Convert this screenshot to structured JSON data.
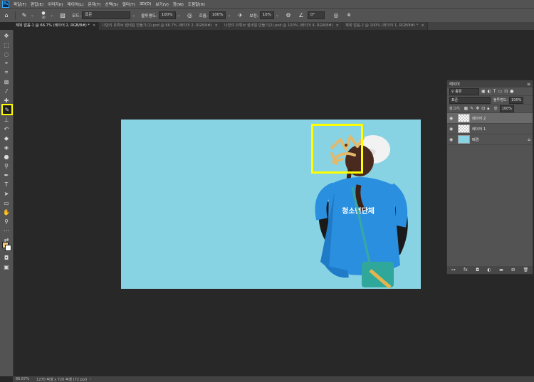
{
  "app": {
    "logo": "Ps"
  },
  "menu": [
    "파일(F)",
    "편집(E)",
    "이미지(I)",
    "레이어(L)",
    "문자(Y)",
    "선택(S)",
    "필터(T)",
    "3D(D)",
    "보기(V)",
    "창(W)",
    "도움말(H)"
  ],
  "options": {
    "brush_size": "30",
    "mode_label": "모드:",
    "mode_value": "표준",
    "opacity_label": "불투명도:",
    "opacity_value": "100%",
    "flow_label": "흐름:",
    "flow_value": "100%",
    "smoothing_label": "보정:",
    "smoothing_value": "10%",
    "angle_value": "0°"
  },
  "tabs": [
    {
      "label": "제목 없음-1 @ 66.7% (레이어 2, RGB/8#) *",
      "active": true
    },
    {
      "label": "나만의 유튜브 썸네일 만들기(1).psd @ 66.7% (레이어 2, RGB/8#)",
      "active": false
    },
    {
      "label": "나만의 유튜브 썸네일 만들기(2).psd @ 100% (레이어 4, RGB/8#)",
      "active": false
    },
    {
      "label": "제목 없음-2 @ 100% (레이어 1, RGB/8#) *",
      "active": false
    }
  ],
  "status": {
    "zoom": "66.67%",
    "doc_info": "1270 픽셀 x 720 픽셀 (72 ppi)"
  },
  "layers_panel": {
    "title": "레이어",
    "filter_label": "종류",
    "blend_mode": "표준",
    "opacity_label": "불투명도:",
    "opacity_value": "100%",
    "lock_label": "잠그기:",
    "fill_label": "칠:",
    "fill_value": "100%",
    "layers": [
      {
        "name": "레이어 2",
        "active": true,
        "thumb": "checker"
      },
      {
        "name": "레이어 1",
        "active": false,
        "thumb": "checker"
      },
      {
        "name": "배경",
        "active": false,
        "thumb": "fill"
      }
    ]
  },
  "canvas": {
    "background_color": "#88d3e3",
    "shirt_text": "청소년단체"
  },
  "colors": {
    "foreground": "#f2c97a",
    "background": "#ffffff",
    "highlight": "#ffff00"
  }
}
